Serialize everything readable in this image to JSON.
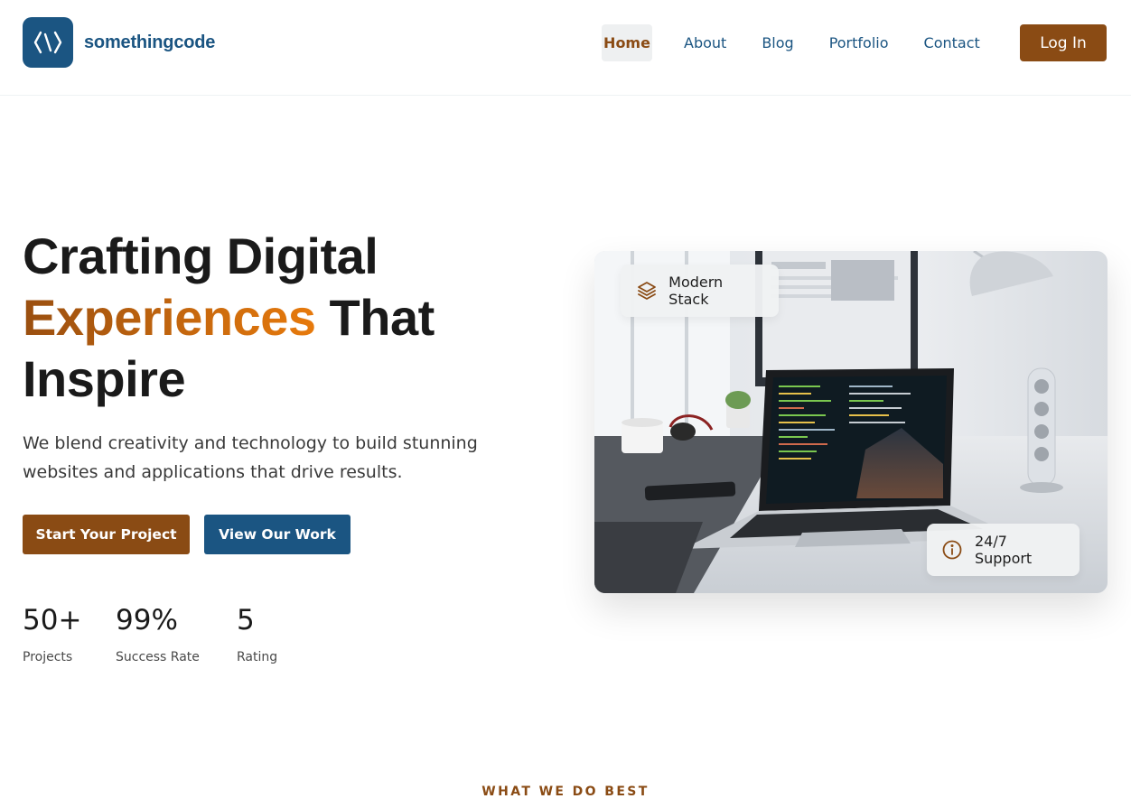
{
  "header": {
    "brand": "somethingcode",
    "logo_icon": "code-brackets-icon",
    "nav": [
      {
        "label": "Home",
        "active": true
      },
      {
        "label": "About",
        "active": false
      },
      {
        "label": "Blog",
        "active": false
      },
      {
        "label": "Portfolio",
        "active": false
      },
      {
        "label": "Contact",
        "active": false
      }
    ],
    "login_label": "Log In"
  },
  "hero": {
    "title_line1": "Crafting Digital",
    "title_accent": "Experiences",
    "title_line2_rest": " That",
    "title_line3": "Inspire",
    "subtitle": "We blend creativity and technology to build stunning websites and applications that drive results.",
    "primary_cta": "Start Your Project",
    "secondary_cta": "View Our Work",
    "stats": [
      {
        "value": "50+",
        "label": "Projects"
      },
      {
        "value": "99%",
        "label": "Success Rate"
      },
      {
        "value": "5",
        "label": "Rating"
      }
    ],
    "image_badges": [
      {
        "label": "Modern Stack",
        "icon": "layers-icon"
      },
      {
        "label": "24/7 Support",
        "icon": "info-circle-icon"
      }
    ]
  },
  "section": {
    "eyebrow": "WHAT WE DO BEST"
  },
  "colors": {
    "brand_blue": "#1b5582",
    "brand_brown": "#8a4b14",
    "accent_orange": "#e77a0c"
  }
}
